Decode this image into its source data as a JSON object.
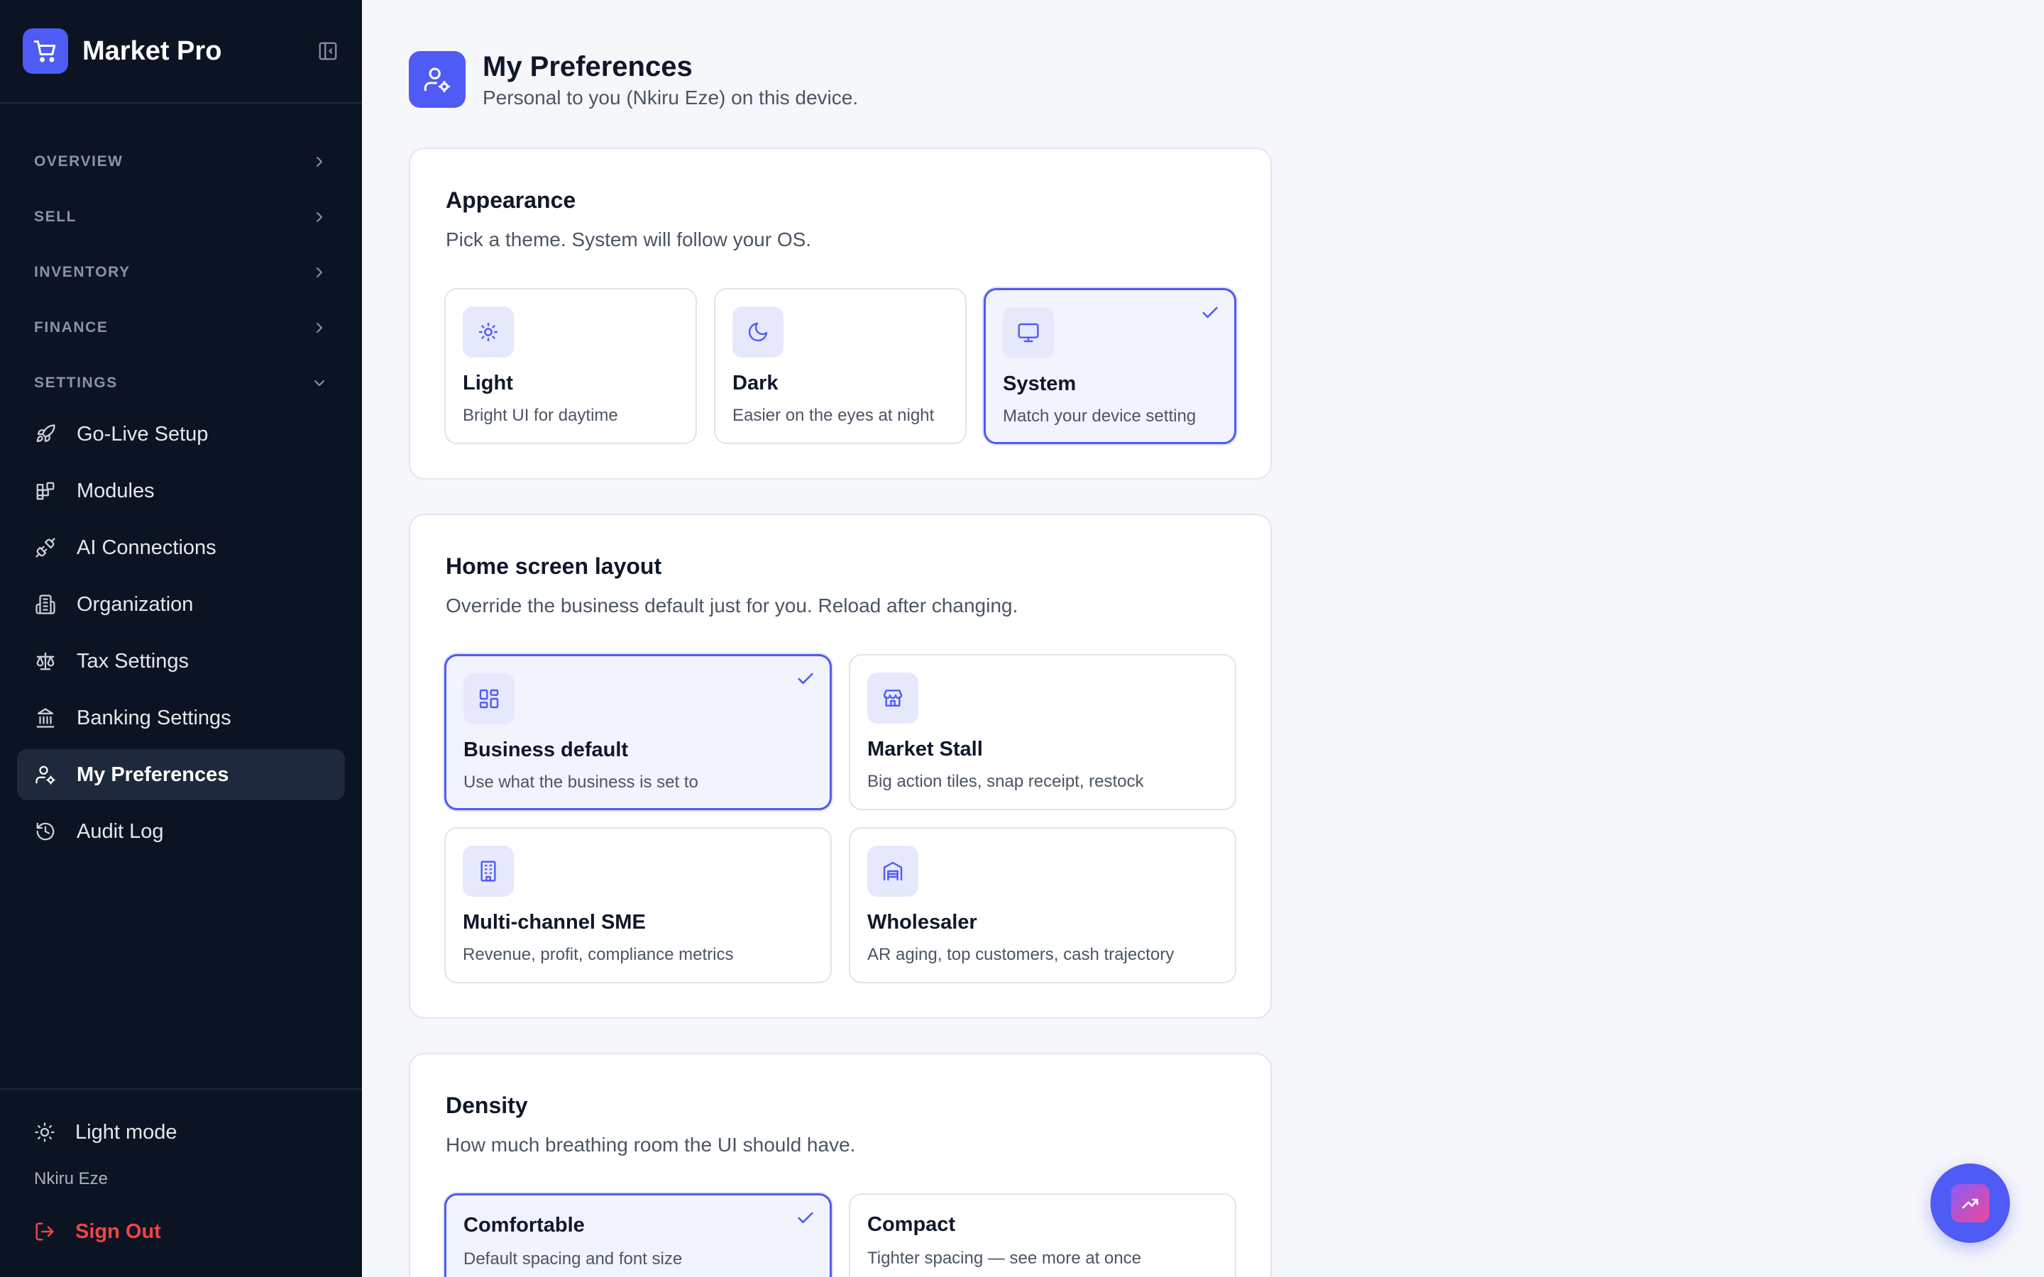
{
  "app": {
    "name": "Market Pro"
  },
  "sidebar": {
    "sections": [
      {
        "label": "OVERVIEW",
        "expanded": false
      },
      {
        "label": "SELL",
        "expanded": false
      },
      {
        "label": "INVENTORY",
        "expanded": false
      },
      {
        "label": "FINANCE",
        "expanded": false
      },
      {
        "label": "SETTINGS",
        "expanded": true
      }
    ],
    "items": [
      {
        "label": "Go-Live Setup",
        "icon": "rocket-icon"
      },
      {
        "label": "Modules",
        "icon": "modules-icon"
      },
      {
        "label": "AI Connections",
        "icon": "plug-icon"
      },
      {
        "label": "Organization",
        "icon": "building-icon"
      },
      {
        "label": "Tax Settings",
        "icon": "scale-icon"
      },
      {
        "label": "Banking Settings",
        "icon": "bank-icon"
      },
      {
        "label": "My Preferences",
        "icon": "user-cog-icon",
        "active": true
      },
      {
        "label": "Audit Log",
        "icon": "history-icon"
      }
    ],
    "light_mode_label": "Light mode",
    "user_name": "Nkiru Eze",
    "sign_out_label": "Sign Out"
  },
  "page": {
    "title": "My Preferences",
    "subtitle": "Personal to you (Nkiru Eze) on this device."
  },
  "appearance": {
    "title": "Appearance",
    "desc": "Pick a theme. System will follow your OS.",
    "selected": "System",
    "options": [
      {
        "title": "Light",
        "desc": "Bright UI for daytime",
        "icon": "sun-icon"
      },
      {
        "title": "Dark",
        "desc": "Easier on the eyes at night",
        "icon": "moon-icon"
      },
      {
        "title": "System",
        "desc": "Match your device setting",
        "icon": "monitor-icon"
      }
    ]
  },
  "layout": {
    "title": "Home screen layout",
    "desc": "Override the business default just for you. Reload after changing.",
    "selected": "Business default",
    "options": [
      {
        "title": "Business default",
        "desc": "Use what the business is set to",
        "icon": "grid-icon"
      },
      {
        "title": "Market Stall",
        "desc": "Big action tiles, snap receipt, restock",
        "icon": "store-icon"
      },
      {
        "title": "Multi-channel SME",
        "desc": "Revenue, profit, compliance metrics",
        "icon": "office-icon"
      },
      {
        "title": "Wholesaler",
        "desc": "AR aging, top customers, cash trajectory",
        "icon": "warehouse-icon"
      }
    ]
  },
  "density": {
    "title": "Density",
    "desc": "How much breathing room the UI should have.",
    "selected": "Comfortable",
    "options": [
      {
        "title": "Comfortable",
        "desc": "Default spacing and font size"
      },
      {
        "title": "Compact",
        "desc": "Tighter spacing — see more at once"
      }
    ]
  },
  "colors": {
    "sidebar_bg": "#0c1322",
    "accent": "#4f5bf5",
    "danger": "#ef4444",
    "page_bg": "#f6f7fb"
  }
}
